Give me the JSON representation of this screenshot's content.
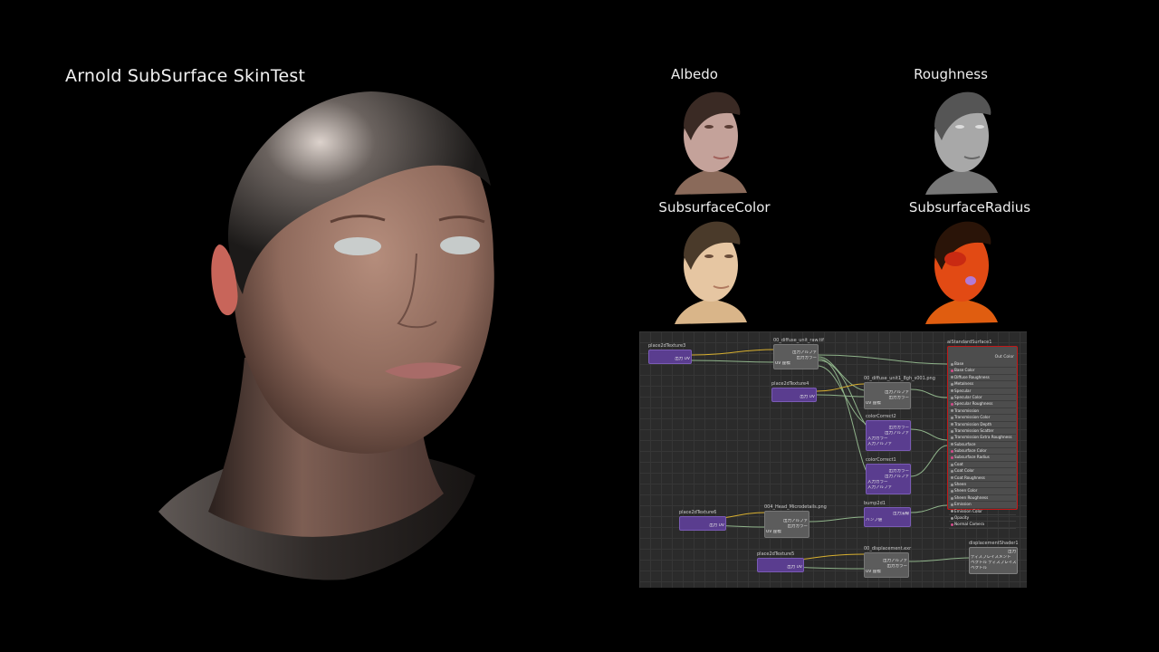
{
  "title": "Arnold SubSurface SkinTest",
  "maps": [
    {
      "label": "Albedo",
      "kind": "albedo"
    },
    {
      "label": "Roughness",
      "kind": "roughness"
    },
    {
      "label": "SubsurfaceColor",
      "kind": "sss_color"
    },
    {
      "label": "SubsurfaceRadius",
      "kind": "sss_radius"
    }
  ],
  "node_editor": {
    "nodes": {
      "place1": {
        "name": "place2dTexture3",
        "rows": [
          "出力 UV"
        ]
      },
      "file1": {
        "name": "00_diffuse_unit_raw.tif",
        "rows": [
          "出力アルファ",
          "出力カラー",
          "UV 座標"
        ]
      },
      "place2": {
        "name": "place2dTexture4",
        "rows": [
          "出力 UV"
        ]
      },
      "file2": {
        "name": "00_diffuse_unit1_8gh_s001.png",
        "rows": [
          "出力アルファ",
          "出力カラー",
          "UV 座標"
        ]
      },
      "cc1": {
        "name": "colorCorrect2",
        "rows": [
          "出力カラー",
          "出力アルファ",
          "入力カラー",
          "入力アルファ"
        ]
      },
      "cc2": {
        "name": "colorCorrect1",
        "rows": [
          "出力カラー",
          "出力アルファ",
          "入力カラー",
          "入力アルファ"
        ]
      },
      "place3": {
        "name": "place2dTexture6",
        "rows": [
          "出力 UV"
        ]
      },
      "file3": {
        "name": "004_Head_Microdetails.png",
        "rows": [
          "出力アルファ",
          "出力カラー",
          "UV 座標"
        ]
      },
      "bump": {
        "name": "bump2d1",
        "rows": [
          "出力法線",
          "バンプ値"
        ]
      },
      "place4": {
        "name": "place2dTexture5",
        "rows": [
          "出力 UV"
        ]
      },
      "file4": {
        "name": "00_displacement.exr",
        "rows": [
          "出力アルファ",
          "出力カラー",
          "UV 座標"
        ]
      },
      "disp": {
        "name": "displacementShader1",
        "rows": [
          "出力",
          "ディスプレイスメント",
          "ベクトル ディスプレイスメント",
          "ベクトル"
        ]
      },
      "shader": {
        "name": "aiStandardSurface1",
        "out_label": "Out Color",
        "attrs": [
          "Base",
          "Base Color",
          "Diffuse Roughness",
          "Metalness",
          "Specular",
          "Specular Color",
          "Specular Roughness",
          "Transmission",
          "Transmission Color",
          "Transmission Depth",
          "Transmission Scatter",
          "Transmission Extra Roughness",
          "Subsurface",
          "Subsurface Color",
          "Subsurface Radius",
          "Coat",
          "Coat Color",
          "Coat Roughness",
          "Sheen",
          "Sheen Color",
          "Sheen Roughness",
          "Emission",
          "Emission Color",
          "Opacity",
          "Normal Camera"
        ],
        "wired_attrs": [
          "Base Color",
          "Specular Roughness",
          "Subsurface Color",
          "Subsurface Radius",
          "Normal Camera"
        ]
      }
    }
  },
  "colors": {
    "purple_node": "#5a3d8f",
    "gray_node": "#5c5c5c",
    "shader_border": "#c01818",
    "wire_yellow": "#d8b030",
    "wire_green": "#8fb38a"
  }
}
